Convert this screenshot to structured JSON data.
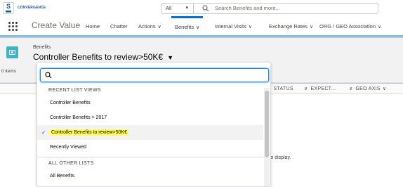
{
  "brand": {
    "app_brand": "CONVERGENCE",
    "logo_letter": "S"
  },
  "search": {
    "scope": "All",
    "placeholder": "Search Benefits and more..."
  },
  "nav": {
    "app_name": "Create Value",
    "items": [
      {
        "label": "Home",
        "has_menu": false
      },
      {
        "label": "Chatter",
        "has_menu": false
      },
      {
        "label": "Actions",
        "has_menu": true
      },
      {
        "label": "Benefits",
        "has_menu": true,
        "active": true
      },
      {
        "label": "Internal Visits",
        "has_menu": true
      },
      {
        "label": "Exchange Rates",
        "has_menu": true
      },
      {
        "label": "ORG / GEO Association",
        "has_menu": true
      }
    ]
  },
  "page_header": {
    "object_label": "Benefits",
    "list_title": "Controller Benefits to review>50K€",
    "items_count": "0 items"
  },
  "grid": {
    "columns": [
      "STATUS",
      "EXPECT...",
      "GEO AXIS"
    ],
    "empty_message": "s to display."
  },
  "dropdown": {
    "recent_header": "RECENT LIST VIEWS",
    "recent_items": [
      {
        "label": "Controller Benefits",
        "selected": false
      },
      {
        "label": "Controller Benefits > 2017",
        "selected": false
      },
      {
        "label": "Controller Benefits to review>50K€",
        "selected": true
      },
      {
        "label": "Recently Viewed",
        "selected": false
      }
    ],
    "other_header": "ALL OTHER LISTS",
    "other_items": [
      {
        "label": "All Benefits"
      }
    ]
  },
  "colors": {
    "accent": "#0070d2",
    "object_icon": "#3cb4c6",
    "highlight": "#fffd5a",
    "background": "#b0c4df"
  },
  "icons": [
    "search-icon",
    "waffle-icon",
    "chevron-down-icon",
    "check-icon",
    "benefits-object-icon"
  ]
}
